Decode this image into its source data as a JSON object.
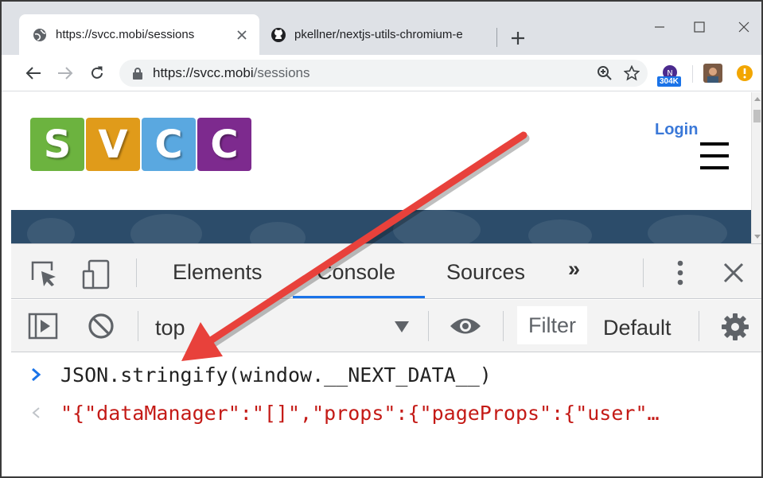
{
  "tabs": [
    {
      "title": "https://svcc.mobi/sessions",
      "icon": "globe-icon",
      "active": true
    },
    {
      "title": "pkellner/nextjs-utils-chromium-e",
      "icon": "github-icon",
      "active": false
    }
  ],
  "toolbar": {
    "url_host": "https://svcc.mobi",
    "url_path": "/sessions",
    "extension_badge": "304K"
  },
  "page": {
    "logo_letters": [
      "S",
      "V",
      "C",
      "C"
    ],
    "logo_colors": [
      "#6cb33f",
      "#e09b1a",
      "#5aa8e0",
      "#7d2a8e"
    ],
    "login_label": "Login"
  },
  "devtools": {
    "tabs": [
      "Elements",
      "Console",
      "Sources"
    ],
    "active_tab": "Console",
    "more_tabs": "»",
    "context": "top",
    "filter_placeholder": "Filter",
    "levels_label": "Default",
    "command": "JSON.stringify(window.__NEXT_DATA__)",
    "result": "\"{\"dataManager\":\"[]\",\"props\":{\"pageProps\":{\"user\"…"
  },
  "annotation": {
    "arrow_color": "#e8413b"
  }
}
